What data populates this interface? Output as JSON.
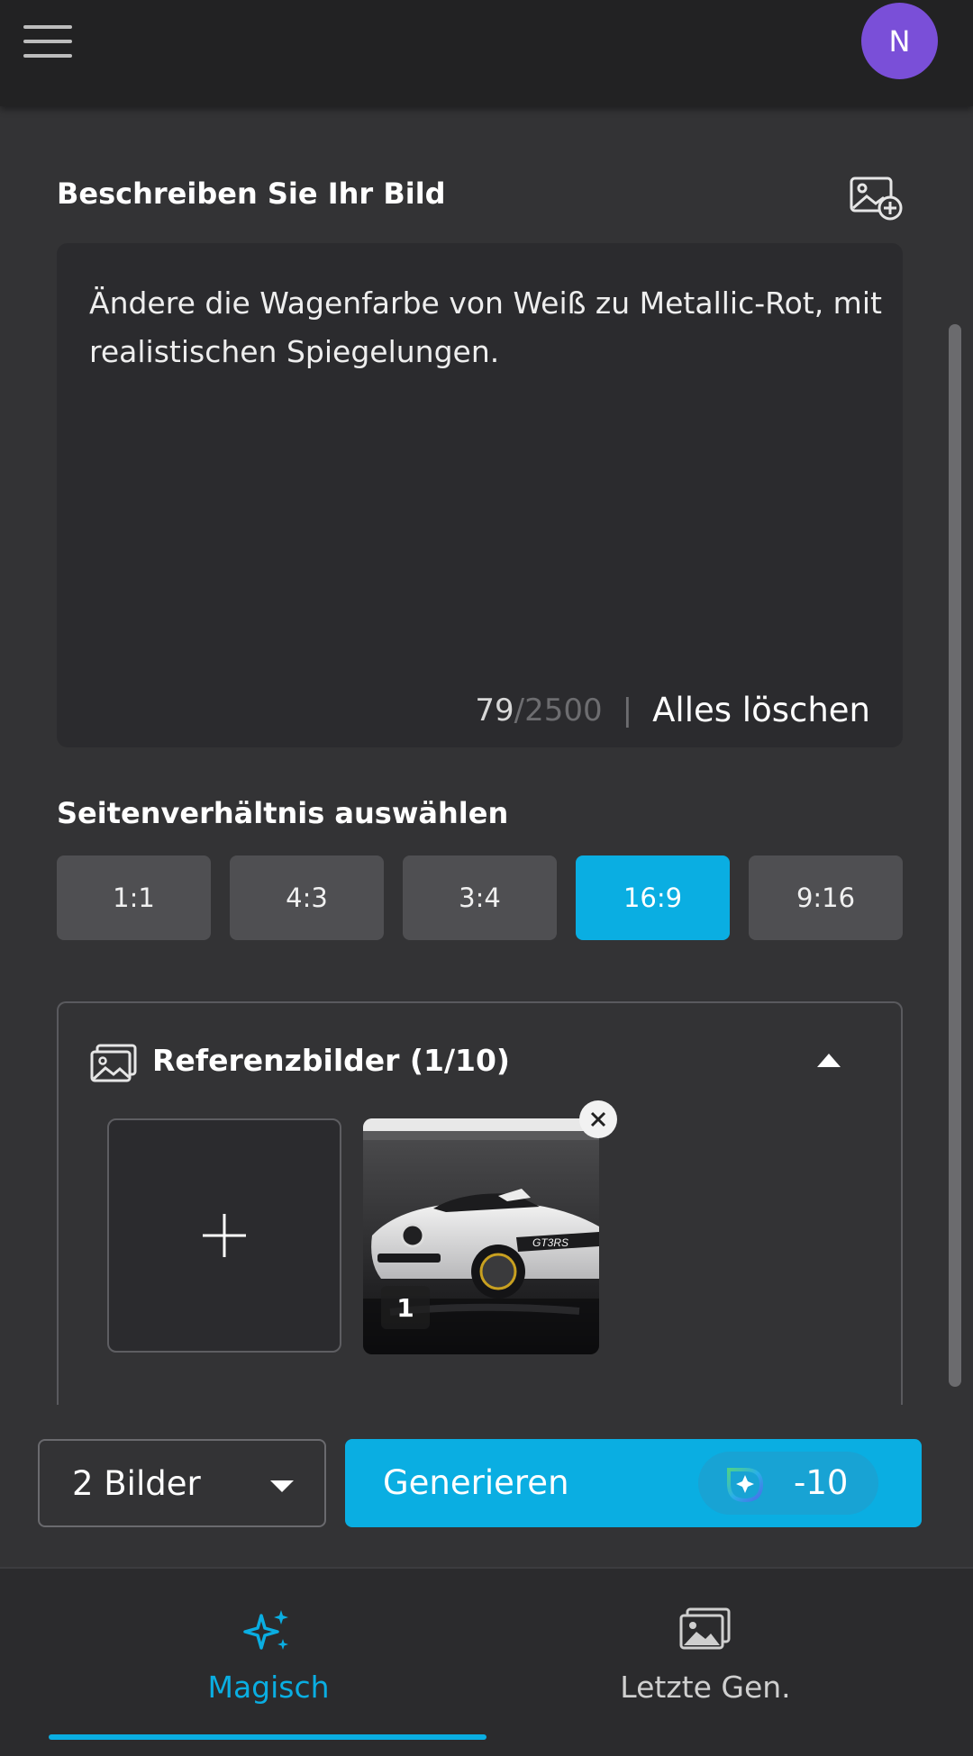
{
  "header": {
    "menu_icon": "hamburger-menu-icon",
    "avatar_letter": "N",
    "avatar_color": "#7a4fd8"
  },
  "prompt": {
    "title": "Beschreiben Sie Ihr Bild",
    "add_image_icon": "image-plus-icon",
    "text": "Ändere die Wagenfarbe von Weiß zu Metallic-Rot, mit realistischen Spiegelungen.",
    "char_count": "79",
    "char_max": "/2500",
    "separator": "|",
    "clear_label": "Alles löschen"
  },
  "aspect_ratio": {
    "title": "Seitenverhältnis auswählen",
    "options": [
      "1:1",
      "4:3",
      "3:4",
      "16:9",
      "9:16"
    ],
    "selected": "16:9"
  },
  "references": {
    "title": "Referenzbilder (1/10)",
    "icon": "images-icon",
    "collapse_icon": "caret-up-icon",
    "add_icon": "plus-icon",
    "items": [
      {
        "badge": "1",
        "remove_icon": "close-icon",
        "image": "white-sports-car-photo"
      }
    ]
  },
  "actions": {
    "quantity_value": "2 Bilder",
    "generate_label": "Generieren",
    "cost": "-10",
    "credit_icon": "sparkle-credit-icon"
  },
  "nav": {
    "items": [
      {
        "label": "Magisch",
        "icon": "sparkles-icon",
        "active": true
      },
      {
        "label": "Letzte Gen.",
        "icon": "gallery-icon",
        "active": false
      }
    ]
  },
  "colors": {
    "accent": "#0aaee2",
    "background": "#333335",
    "surface": "#2b2b2e",
    "topbar": "#222223"
  }
}
